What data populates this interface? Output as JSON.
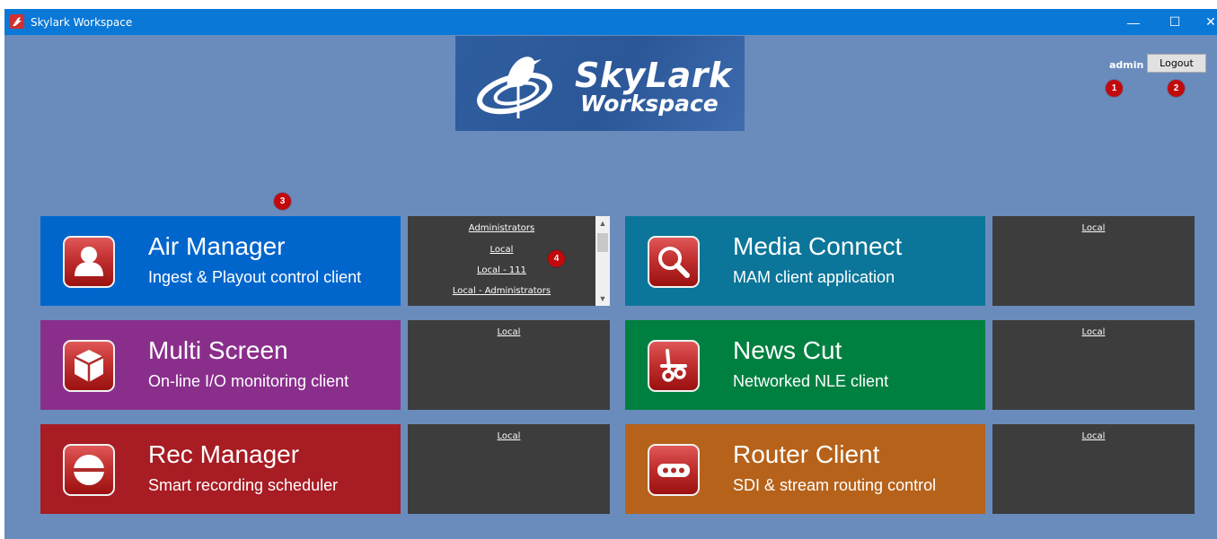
{
  "window": {
    "title": "Skylark Workspace",
    "controls": {
      "minimize": "—",
      "maximize": "☐",
      "close": "✕"
    }
  },
  "logo": {
    "line1": "SkyLark",
    "line2": "Workspace"
  },
  "header": {
    "user": "admin",
    "logout_label": "Logout"
  },
  "markers": [
    "1",
    "2",
    "3",
    "4"
  ],
  "apps": [
    {
      "title": "Air Manager",
      "subtitle": "Ingest & Playout control client",
      "color": "#0066cc",
      "icon": "user-icon",
      "profiles": [
        "Administrators",
        "Local",
        "Local - 111",
        "Local - Administrators"
      ]
    },
    {
      "title": "Media Connect",
      "subtitle": "MAM client application",
      "color": "#0b7699",
      "icon": "magnifier-icon",
      "profiles": [
        "Local"
      ]
    },
    {
      "title": "Multi Screen",
      "subtitle": "On-line I/O monitoring client",
      "color": "#8a2e8c",
      "icon": "cube-icon",
      "profiles": [
        "Local"
      ]
    },
    {
      "title": "News Cut",
      "subtitle": "Networked NLE client",
      "color": "#008040",
      "icon": "scissors-icon",
      "profiles": [
        "Local"
      ]
    },
    {
      "title": "Rec Manager",
      "subtitle": "Smart recording scheduler",
      "color": "#a81c24",
      "icon": "record-icon",
      "profiles": [
        "Local"
      ]
    },
    {
      "title": "Router Client",
      "subtitle": "SDI & stream routing control",
      "color": "#b6621a",
      "icon": "ellipsis-icon",
      "profiles": [
        "Local"
      ]
    }
  ]
}
